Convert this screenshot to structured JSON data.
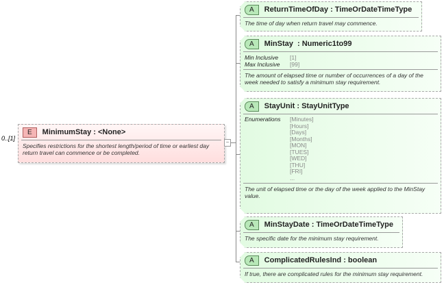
{
  "root": {
    "cardinality": "0..[1]",
    "badge": "E",
    "name": "MinimumStay",
    "type": ": <None>",
    "description": "Specifies restrictions for the shortest length/period of time or earliest day return travel can commence or be completed.",
    "collapse_symbol": "−"
  },
  "attributes": [
    {
      "badge": "A",
      "name": "ReturnTimeOfDay",
      "type": ": TimeOrDateTimeType",
      "description": "The time of day when return travel may commence."
    },
    {
      "badge": "A",
      "name": "MinStay",
      "type": ": Numeric1to99",
      "facets": [
        {
          "key": "Min Inclusive",
          "value": "[1]"
        },
        {
          "key": "Max Inclusive",
          "value": "[99]"
        }
      ],
      "description": "The amount of elapsed time or number of occurrences of a day of the week needed to satisfy a minimum stay requirement."
    },
    {
      "badge": "A",
      "name": "StayUnit",
      "type": ": StayUnitType",
      "enum_label": "Enumerations",
      "enumerations": [
        "[Minutes]",
        "[Hours]",
        "[Days]",
        "[Months]",
        "[MON]",
        "[TUES]",
        "[WED]",
        "[THU]",
        "[FRI]",
        "..."
      ],
      "description": "The unit of elapsed time or the day of the week applied to the MinStay value."
    },
    {
      "badge": "A",
      "name": "MinStayDate",
      "type": ": TimeOrDateTimeType",
      "description": "The specific date for the minimum stay requirement."
    },
    {
      "badge": "A",
      "name": "ComplicatedRulesInd",
      "type": ": boolean",
      "description": "If true, there are complicated rules for the minimum stay requirement."
    }
  ]
}
